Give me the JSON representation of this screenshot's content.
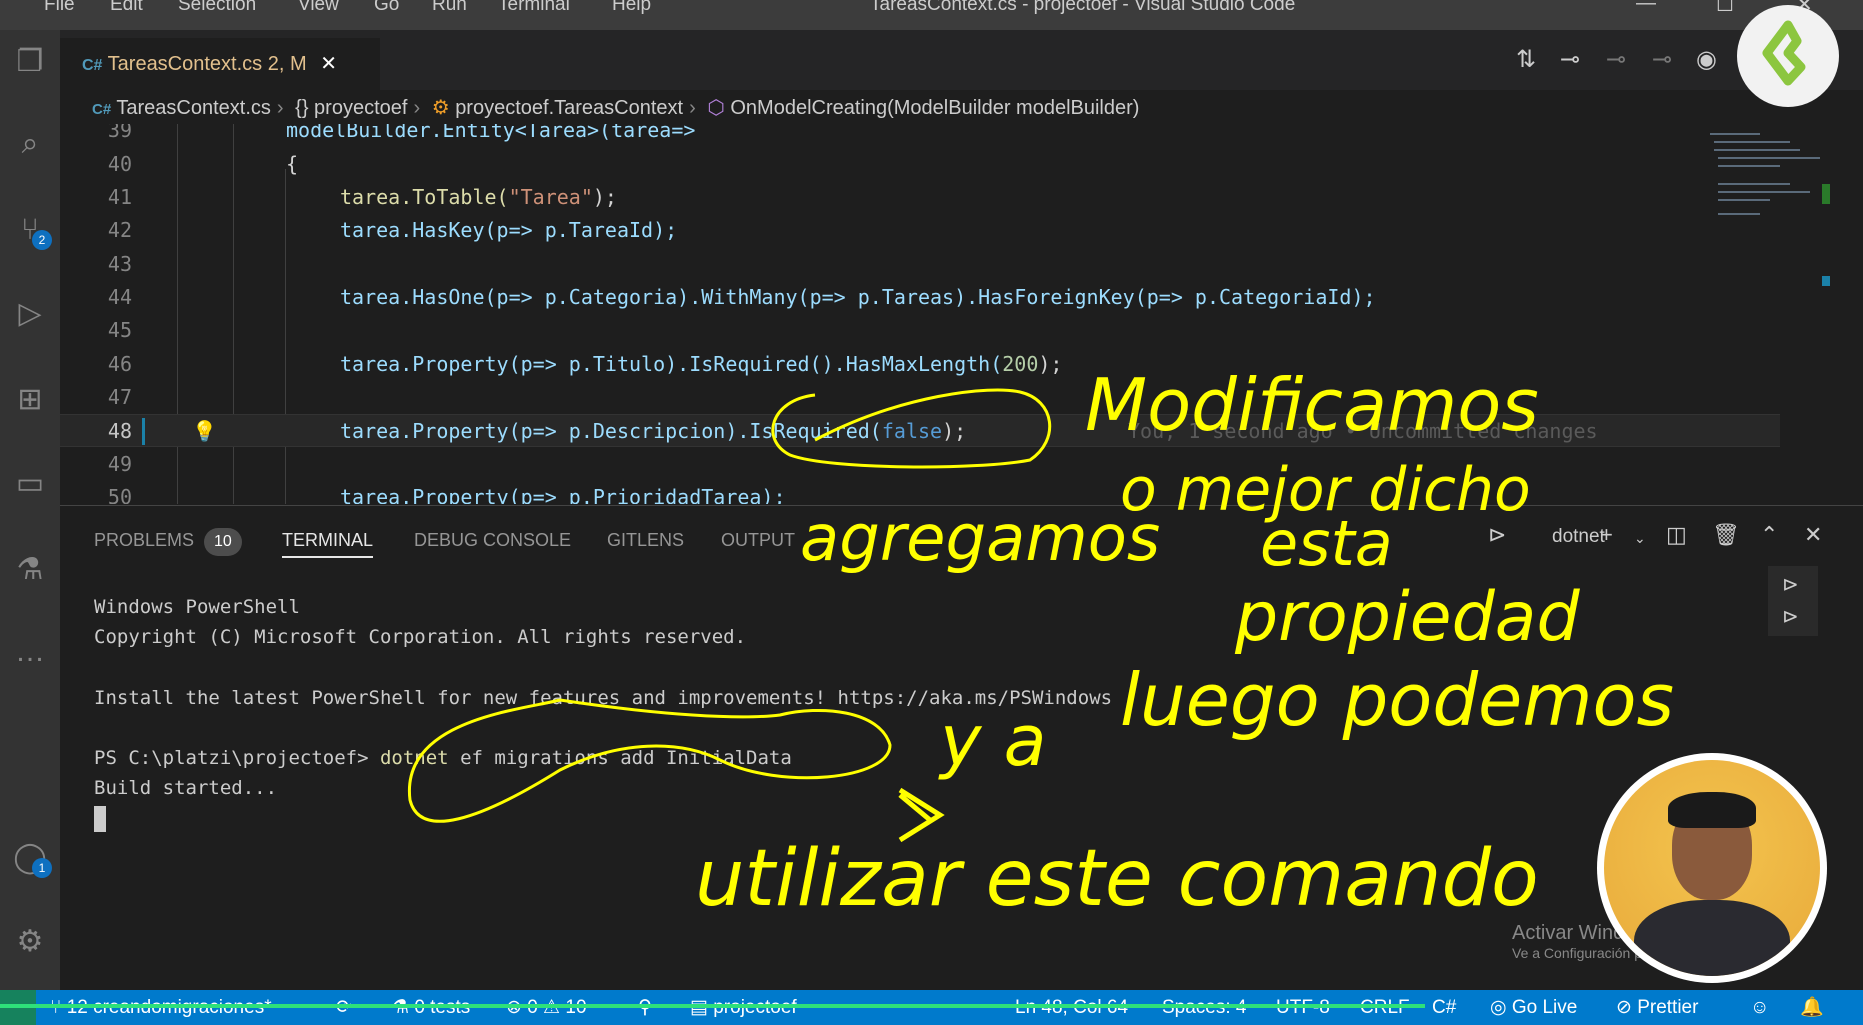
{
  "titlebar": {
    "menu": [
      "File",
      "Edit",
      "Selection",
      "View",
      "Go",
      "Run",
      "Terminal",
      "Help"
    ],
    "title": "TareasContext.cs - projectoef - Visual Studio Code"
  },
  "activity": {
    "source_control_badge": "2",
    "accounts_badge": "1"
  },
  "tab": {
    "icon": "C#",
    "name": "TareasContext.cs",
    "status": "2, M",
    "close": "✕"
  },
  "breadcrumb": [
    "TareasContext.cs",
    "{} proyectoef",
    "proyectoef.TareasContext",
    "OnModelCreating(ModelBuilder modelBuilder)"
  ],
  "editor": {
    "line_numbers": [
      "39",
      "40",
      "41",
      "42",
      "43",
      "44",
      "45",
      "46",
      "47",
      "48",
      "49",
      "50"
    ],
    "lines": {
      "l39": "modelBuilder.Entity<Tarea>(tarea=>",
      "l40": "{",
      "l41a": "tarea.ToTable(",
      "l41b": "\"Tarea\"",
      "l41c": ");",
      "l42": "tarea.HasKey(p=> p.TareaId);",
      "l44": "tarea.HasOne(p=> p.Categoria).WithMany(p=> p.Tareas).HasForeignKey(p=> p.CategoriaId);",
      "l46a": "tarea.Property(p=> p.Titulo).IsRequired().HasMaxLength(",
      "l46b": "200",
      "l46c": ");",
      "l48a": "tarea.Property(p=> p.Descripcion).IsRequired(",
      "l48b": "false",
      "l48c": ");",
      "l50": "tarea.Property(p=> p.PrioridadTarea);"
    },
    "blame": "You, 1 second ago • Uncommitted changes"
  },
  "panel": {
    "tabs": [
      "PROBLEMS",
      "TERMINAL",
      "DEBUG CONSOLE",
      "GITLENS",
      "OUTPUT"
    ],
    "problems_count": "10",
    "terminal_name": "dotnet",
    "terminal_lines": [
      "Windows PowerShell",
      "Copyright (C) Microsoft Corporation. All rights reserved.",
      "",
      "Install the latest PowerShell for new features and improvements! https://aka.ms/PSWindows",
      "",
      "PS C:\\platzi\\projectoef> ",
      "Build started..."
    ],
    "prompt_command": "dotnet",
    "prompt_args": " ef migrations add InitialData"
  },
  "statusbar": {
    "branch": "12 creandomigraciones*",
    "tests": "0 tests",
    "errors": "0",
    "warnings": "10",
    "project": "projectoef",
    "position": "Ln 48, Col 64",
    "spaces": "Spaces: 4",
    "encoding": "UTF-8",
    "eol": "CRLF",
    "language": "C#",
    "golive": "Go Live",
    "prettier": "Prettier"
  },
  "watermark": {
    "title": "Activar Windows",
    "subtitle": "Ve a Configuración para activar Windows."
  },
  "annotations": [
    "Modificamos",
    "o mejor dicho",
    "agregamos",
    "esta",
    "propiedad",
    "y a",
    "luego podemos",
    "utilizar este comando"
  ],
  "colors": {
    "statusbar": "#007acc",
    "annotation": "#ffff00",
    "logo": "#8cc63f"
  }
}
